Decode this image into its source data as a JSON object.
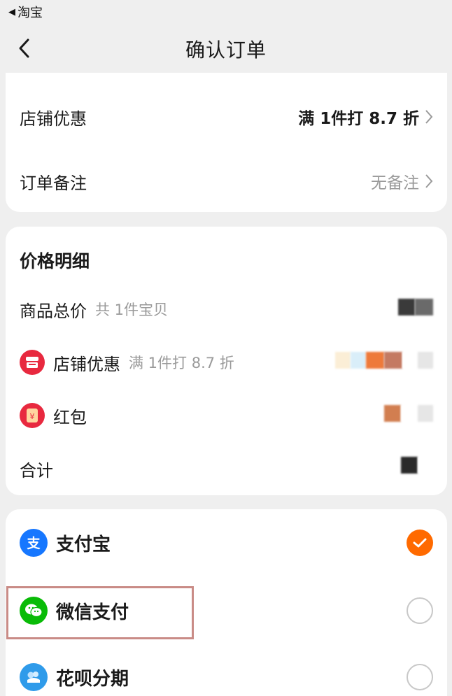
{
  "status_bar": {
    "back_app_label": "淘宝"
  },
  "nav": {
    "title": "确认订单"
  },
  "summary": {
    "shop_discount_label": "店铺优惠",
    "shop_discount_value": "满 1件打 8.7 折",
    "order_note_label": "订单备注",
    "order_note_value": "无备注"
  },
  "price_detail": {
    "title": "价格明细",
    "rows": [
      {
        "label": "商品总价",
        "sub": "共 1件宝贝"
      },
      {
        "label": "店铺优惠",
        "sub": "满 1件打 8.7 折",
        "icon": "shop-icon"
      },
      {
        "label": "红包",
        "icon": "red-packet-icon"
      },
      {
        "label": "合计"
      }
    ]
  },
  "payment": {
    "methods": [
      {
        "label": "支付宝",
        "icon": "alipay-icon",
        "selected": true
      },
      {
        "label": "微信支付",
        "icon": "wechat-pay-icon",
        "selected": false
      },
      {
        "label": "花呗分期",
        "icon": "huabei-icon",
        "selected": false
      }
    ]
  },
  "colors": {
    "accent": "#ff6a00",
    "shop_red": "#e8293f",
    "alipay_blue": "#1677ff",
    "wechat_green": "#09bb07",
    "huabei_blue": "#2f9bea",
    "highlight": "#c98b86"
  }
}
